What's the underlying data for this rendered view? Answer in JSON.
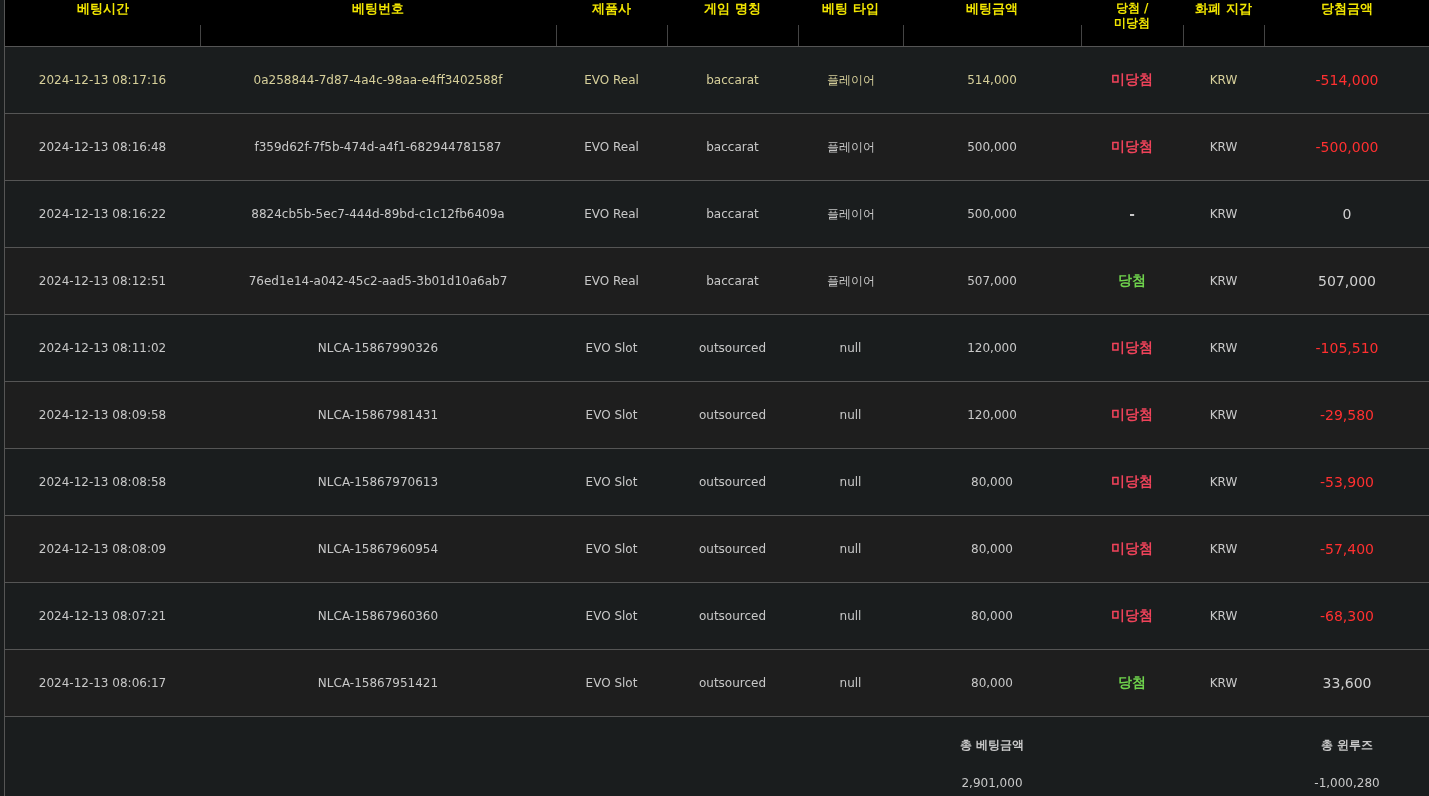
{
  "columns": [
    "베팅시간",
    "베팅번호",
    "제품사",
    "게임 명칭",
    "베팅 타입",
    "베팅금액",
    "당첨 / 미당첨",
    "화폐 지갑",
    "당첨금액"
  ],
  "rows": [
    {
      "selected": true,
      "time": "2024-12-13 08:17:16",
      "bet_id": "0a258844-7d87-4a4c-98aa-e4ff3402588f",
      "provider": "EVO Real",
      "game": "baccarat",
      "bet_type": "플레이어",
      "bet_amount": "514,000",
      "result": {
        "text": "미당첨",
        "color": "#f0435a"
      },
      "currency": "KRW",
      "win_amount": {
        "text": "-514,000",
        "color": "#ff3030"
      }
    },
    {
      "selected": false,
      "time": "2024-12-13 08:16:48",
      "bet_id": "f359d62f-7f5b-474d-a4f1-682944781587",
      "provider": "EVO Real",
      "game": "baccarat",
      "bet_type": "플레이어",
      "bet_amount": "500,000",
      "result": {
        "text": "미당첨",
        "color": "#f0435a"
      },
      "currency": "KRW",
      "win_amount": {
        "text": "-500,000",
        "color": "#ff3030"
      }
    },
    {
      "selected": false,
      "time": "2024-12-13 08:16:22",
      "bet_id": "8824cb5b-5ec7-444d-89bd-c1c12fb6409a",
      "provider": "EVO Real",
      "game": "baccarat",
      "bet_type": "플레이어",
      "bet_amount": "500,000",
      "result": {
        "text": "-",
        "color": "#c8c8c8"
      },
      "currency": "KRW",
      "win_amount": {
        "text": "0",
        "color": "#d0d0d0"
      }
    },
    {
      "selected": false,
      "time": "2024-12-13 08:12:51",
      "bet_id": "76ed1e14-a042-45c2-aad5-3b01d10a6ab7",
      "provider": "EVO Real",
      "game": "baccarat",
      "bet_type": "플레이어",
      "bet_amount": "507,000",
      "result": {
        "text": "당첨",
        "color": "#6fd34c"
      },
      "currency": "KRW",
      "win_amount": {
        "text": "507,000",
        "color": "#d0d0d0"
      }
    },
    {
      "selected": false,
      "time": "2024-12-13 08:11:02",
      "bet_id": "NLCA-15867990326",
      "provider": "EVO Slot",
      "game": "outsourced",
      "bet_type": "null",
      "bet_amount": "120,000",
      "result": {
        "text": "미당첨",
        "color": "#f0435a"
      },
      "currency": "KRW",
      "win_amount": {
        "text": "-105,510",
        "color": "#ff3030"
      }
    },
    {
      "selected": false,
      "time": "2024-12-13 08:09:58",
      "bet_id": "NLCA-15867981431",
      "provider": "EVO Slot",
      "game": "outsourced",
      "bet_type": "null",
      "bet_amount": "120,000",
      "result": {
        "text": "미당첨",
        "color": "#f0435a"
      },
      "currency": "KRW",
      "win_amount": {
        "text": "-29,580",
        "color": "#ff3030"
      }
    },
    {
      "selected": false,
      "time": "2024-12-13 08:08:58",
      "bet_id": "NLCA-15867970613",
      "provider": "EVO Slot",
      "game": "outsourced",
      "bet_type": "null",
      "bet_amount": "80,000",
      "result": {
        "text": "미당첨",
        "color": "#f0435a"
      },
      "currency": "KRW",
      "win_amount": {
        "text": "-53,900",
        "color": "#ff3030"
      }
    },
    {
      "selected": false,
      "time": "2024-12-13 08:08:09",
      "bet_id": "NLCA-15867960954",
      "provider": "EVO Slot",
      "game": "outsourced",
      "bet_type": "null",
      "bet_amount": "80,000",
      "result": {
        "text": "미당첨",
        "color": "#f0435a"
      },
      "currency": "KRW",
      "win_amount": {
        "text": "-57,400",
        "color": "#ff3030"
      }
    },
    {
      "selected": false,
      "time": "2024-12-13 08:07:21",
      "bet_id": "NLCA-15867960360",
      "provider": "EVO Slot",
      "game": "outsourced",
      "bet_type": "null",
      "bet_amount": "80,000",
      "result": {
        "text": "미당첨",
        "color": "#f0435a"
      },
      "currency": "KRW",
      "win_amount": {
        "text": "-68,300",
        "color": "#ff3030"
      }
    },
    {
      "selected": false,
      "time": "2024-12-13 08:06:17",
      "bet_id": "NLCA-15867951421",
      "provider": "EVO Slot",
      "game": "outsourced",
      "bet_type": "null",
      "bet_amount": "80,000",
      "result": {
        "text": "당첨",
        "color": "#6fd34c"
      },
      "currency": "KRW",
      "win_amount": {
        "text": "33,600",
        "color": "#d0d0d0"
      }
    }
  ],
  "totals": {
    "bet_label": "총 베팅금액",
    "bet_value": "2,901,000",
    "winloss_label": "총 윈루즈",
    "winloss_value": "-1,000,280"
  }
}
